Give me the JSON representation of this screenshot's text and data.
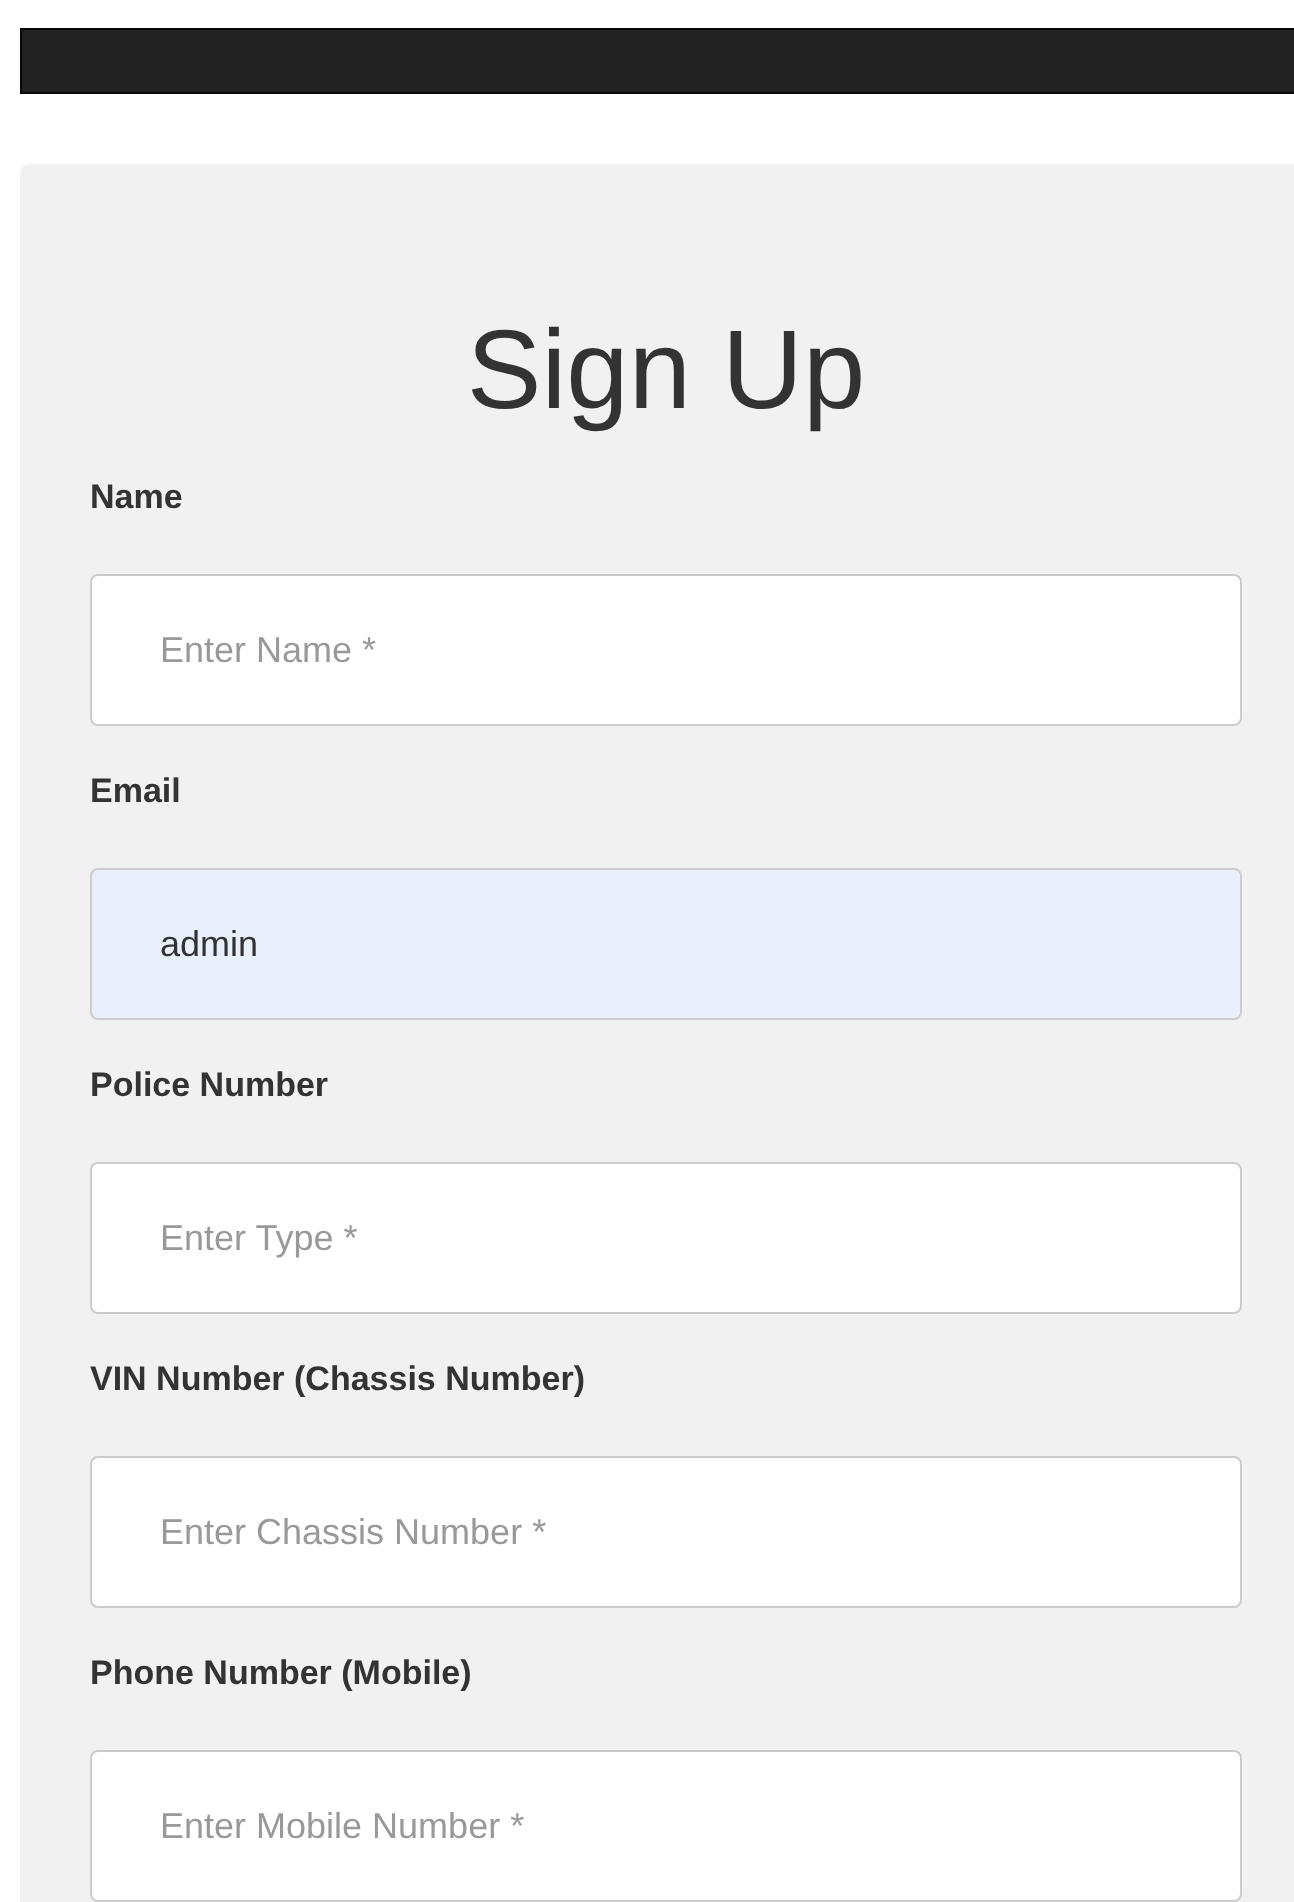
{
  "title": "Sign Up",
  "fields": [
    {
      "label": "Name",
      "placeholder": "Enter Name *",
      "autofilled": false
    },
    {
      "label": "Email",
      "value": "admin",
      "autofilled": true
    },
    {
      "label": "Police Number",
      "placeholder": "Enter Type *",
      "autofilled": false
    },
    {
      "label": "VIN Number (Chassis Number)",
      "placeholder": "Enter Chassis Number *",
      "autofilled": false
    },
    {
      "label": "Phone Number (Mobile)",
      "placeholder": "Enter Mobile Number *",
      "autofilled": false
    }
  ]
}
